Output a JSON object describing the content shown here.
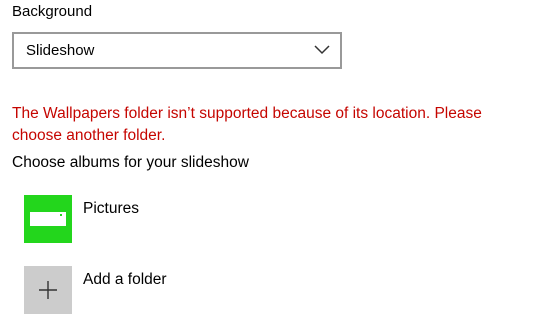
{
  "background": {
    "label": "Background",
    "dropdown_value": "Slideshow"
  },
  "error": {
    "message": "The Wallpapers folder isn’t supported because of its location. Please choose another folder."
  },
  "albums": {
    "label": "Choose albums for your slideshow",
    "items": [
      {
        "label": "Pictures",
        "icon": "pictures-folder-icon"
      },
      {
        "label": "Add a folder",
        "icon": "plus-icon"
      }
    ]
  },
  "colors": {
    "error": "#c50500",
    "pictures_tile": "#23d61c",
    "add_tile": "#cccccc"
  }
}
